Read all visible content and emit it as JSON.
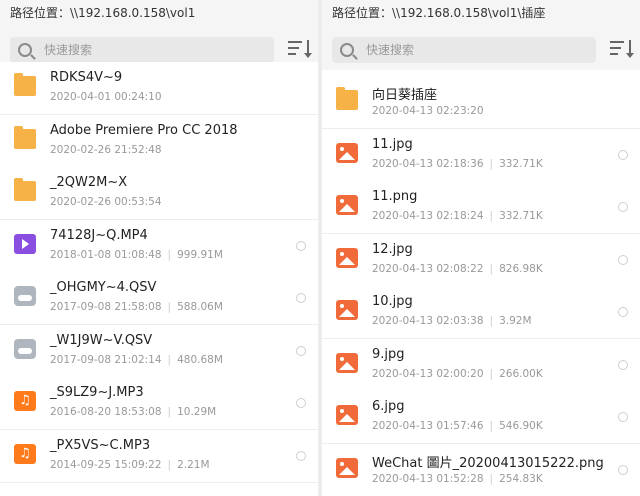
{
  "left": {
    "path": "路径位置：\\\\192.168.0.158\\vol1",
    "search_placeholder": "快速搜索",
    "items": [
      {
        "name": "RDKS4V~9",
        "date": "2020-04-01 00:24:10",
        "size": "",
        "icon": "folder-icon"
      },
      {
        "name": "Adobe Premiere Pro CC 2018",
        "date": "2020-02-26 21:52:48",
        "size": "",
        "icon": "folder-icon"
      },
      {
        "name": "_2QW2M~X",
        "date": "2020-02-26 00:53:54",
        "size": "",
        "icon": "folder-icon"
      },
      {
        "name": "74128J~Q.MP4",
        "date": "2018-01-08 01:08:48",
        "size": "999.91M",
        "icon": "video-file-icon"
      },
      {
        "name": "_OHGMY~4.QSV",
        "date": "2017-09-08 21:58:08",
        "size": "588.06M",
        "icon": "cloud-file-icon"
      },
      {
        "name": "_W1J9W~V.QSV",
        "date": "2017-09-08 21:02:14",
        "size": "480.68M",
        "icon": "cloud-file-icon"
      },
      {
        "name": "_S9LZ9~J.MP3",
        "date": "2016-08-20 18:53:08",
        "size": "10.29M",
        "icon": "music-file-icon"
      },
      {
        "name": "_PX5VS~C.MP3",
        "date": "2014-09-25 15:09:22",
        "size": "2.21M",
        "icon": "music-file-icon"
      }
    ]
  },
  "right": {
    "path": "路径位置：\\\\192.168.0.158\\vol1\\插座",
    "search_placeholder": "快速搜索",
    "items": [
      {
        "name": "向日葵插座",
        "date": "2020-04-13 02:23:20",
        "size": "",
        "icon": "folder-icon"
      },
      {
        "name": "11.jpg",
        "date": "2020-04-13 02:18:36",
        "size": "332.71K",
        "icon": "image-file-icon"
      },
      {
        "name": "11.png",
        "date": "2020-04-13 02:18:24",
        "size": "332.71K",
        "icon": "image-file-icon"
      },
      {
        "name": "12.jpg",
        "date": "2020-04-13 02:08:22",
        "size": "826.98K",
        "icon": "image-file-icon"
      },
      {
        "name": "10.jpg",
        "date": "2020-04-13 02:03:38",
        "size": "3.92M",
        "icon": "image-file-icon"
      },
      {
        "name": "9.jpg",
        "date": "2020-04-13 02:00:20",
        "size": "266.00K",
        "icon": "image-file-icon"
      },
      {
        "name": "6.jpg",
        "date": "2020-04-13 01:57:46",
        "size": "546.90K",
        "icon": "image-file-icon"
      },
      {
        "name": "WeChat 圖片_20200413015222.png",
        "date": "2020-04-13 01:52:28",
        "size": "254.83K",
        "icon": "image-file-icon"
      }
    ]
  }
}
